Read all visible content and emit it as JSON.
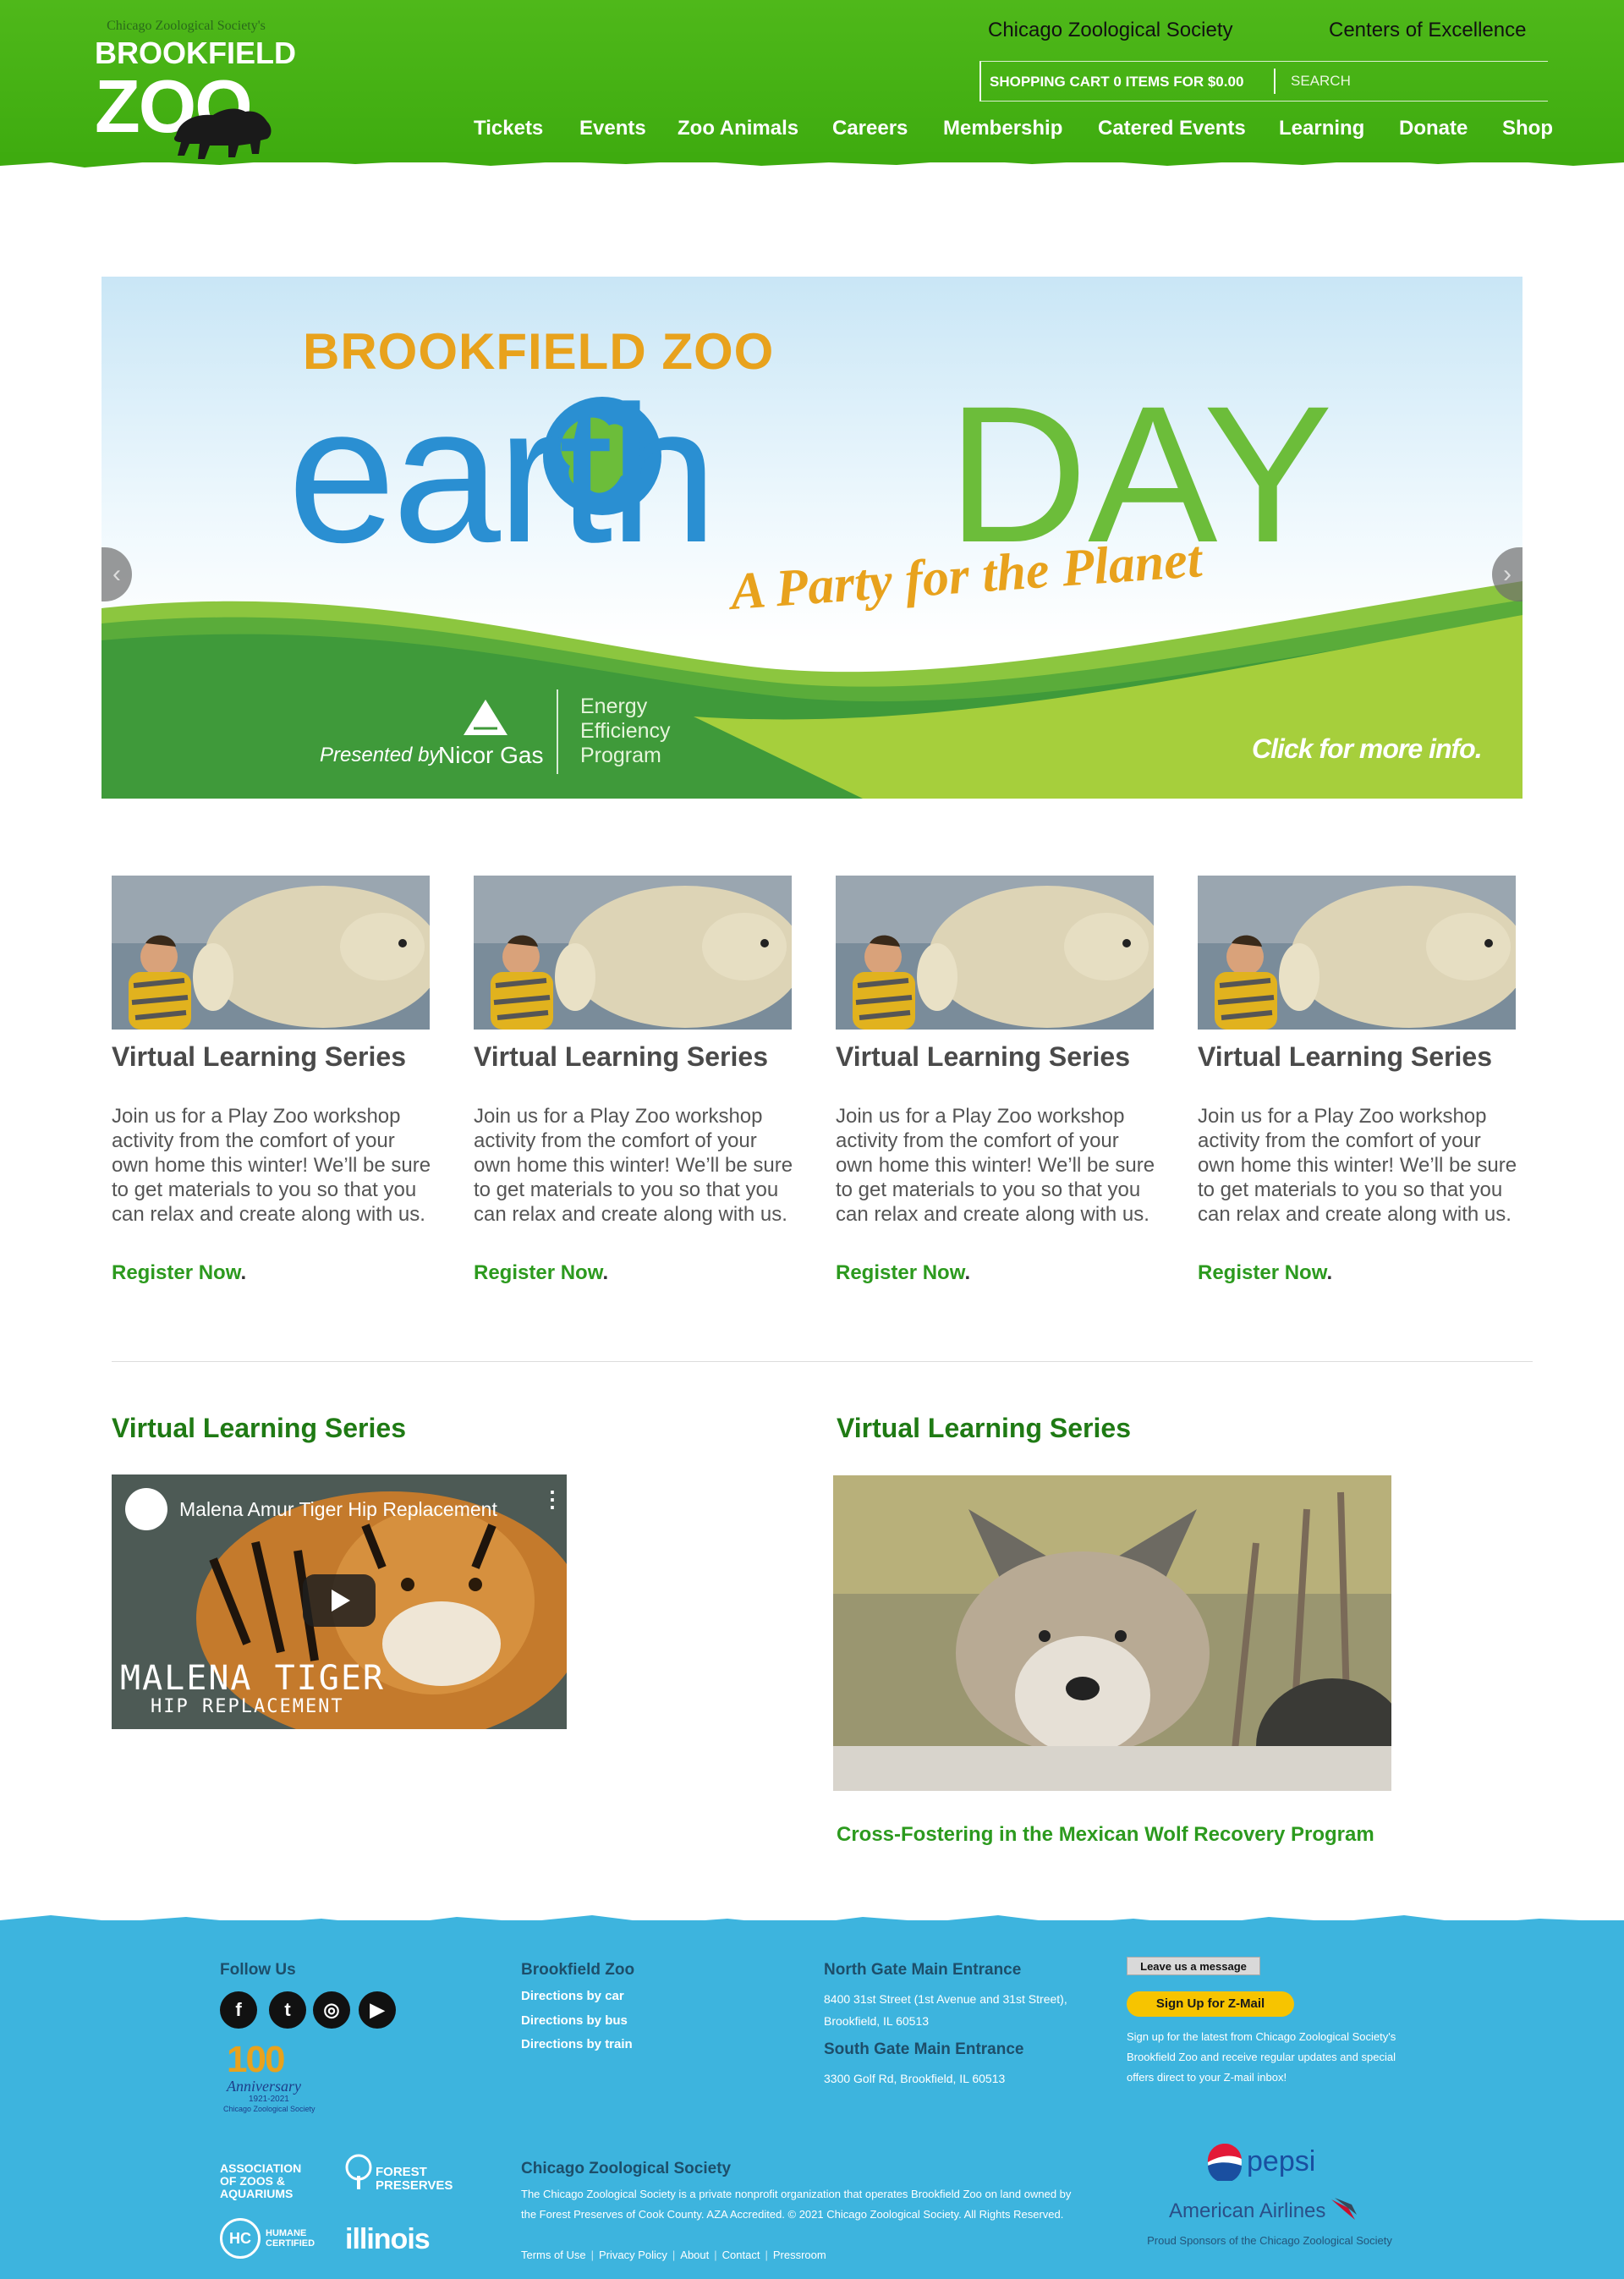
{
  "header": {
    "logo_tagline": "Chicago Zoological Society's",
    "logo_word1": "BROOKFIELD",
    "logo_word2": "ZOO",
    "top_links": [
      "Chicago Zoological Society",
      "Centers of Excellence"
    ],
    "cart_text": "SHOPPING CART 0 ITEMS FOR $0.00",
    "search_placeholder": "SEARCH",
    "nav": [
      "Tickets",
      "Events",
      "Zoo Animals",
      "Careers",
      "Membership",
      "Catered Events",
      "Learning",
      "Donate",
      "Shop"
    ]
  },
  "hero": {
    "brand": "BROOKFIELD ZOO",
    "earth": "earth",
    "day": "DAY",
    "tagline": "A Party for the Planet",
    "presented_by": "Presented by",
    "sponsor": "Nicor Gas",
    "program": "Energy\nEfficiency\nProgram",
    "cta": "Click for more info."
  },
  "cards": [
    {
      "title": "Virtual Learning Series",
      "desc": "Join us for a Play Zoo workshop activity from the comfort of your own home this winter! We’ll be sure to get materials to you so that you can relax and create along with us.",
      "link": "Register Now",
      "punct": "."
    },
    {
      "title": "Virtual Learning Series",
      "desc": "Join us for a Play Zoo workshop activity from the comfort of your own home this winter! We’ll be sure to get materials to you so that you can relax and create along with us.",
      "link": "Register Now",
      "punct": "."
    },
    {
      "title": "Virtual Learning Series",
      "desc": "Join us for a Play Zoo workshop activity from the comfort of your own home this winter! We’ll be sure to get materials to you so that you can relax and create along with us.",
      "link": "Register Now",
      "punct": "."
    },
    {
      "title": "Virtual Learning Series",
      "desc": "Join us for a Play Zoo workshop activity from the comfort of your own home this winter! We’ll be sure to get materials to you so that you can relax and create along with us.",
      "link": "Register Now",
      "punct": "."
    }
  ],
  "features": {
    "left_title": "Virtual Learning Series",
    "video_title": "Malena Amur Tiger Hip Replacement",
    "video_caption_1": "MALENA TIGER",
    "video_caption_2": "HIP REPLACEMENT",
    "right_title": "Virtual Learning Series",
    "wolf_caption": "Cross-Fostering in the Mexican Wolf Recovery Program"
  },
  "footer": {
    "follow_us": "Follow Us",
    "social": [
      "f",
      "t",
      "◎",
      "▶"
    ],
    "anniversary": {
      "number": "100",
      "label": "Anniversary",
      "years": "1921-2021",
      "org": "Chicago Zoological Society"
    },
    "zoo_heading": "Brookfield Zoo",
    "directions": [
      "Directions by car",
      "Directions by bus",
      "Directions by train"
    ],
    "north_heading": "North Gate Main Entrance",
    "north_address": "8400 31st Street (1st Avenue and 31st Street), Brookfield, IL 60513",
    "south_heading": "South Gate Main Entrance",
    "south_address": "3300 Golf Rd, Brookfield, IL 60513",
    "leave_message": "Leave us a message",
    "zmail_button": "Sign Up for Z-Mail",
    "zmail_text": "Sign up for the latest from Chicago Zoological Society's Brookfield Zoo and receive regular updates and special offers direct to your Z-mail inbox!",
    "partners": {
      "aza": "ASSOCIATION OF ZOOS & AQUARIUMS",
      "forest": "FOREST PRESERVES",
      "humane": "HUMANE CERTIFIED",
      "illinois": "illinois"
    },
    "czs_heading": "Chicago Zoological Society",
    "czs_text": "The Chicago Zoological Society is a private nonprofit organization that operates Brookfield Zoo on land owned by the Forest Preserves of Cook County. AZA Accredited. © 2021 Chicago Zoological Society. All Rights Reserved.",
    "legal_links": [
      "Terms of Use",
      "Privacy Policy",
      "About",
      "Contact",
      "Pressroom"
    ],
    "sponsor_pepsi": "pepsi",
    "sponsor_aa": "American Airlines",
    "sponsors_text": "Proud Sponsors of the Chicago Zoological Society"
  },
  "colors": {
    "header_green": "#3eab0f",
    "link_green": "#2c9a1e",
    "heading_green": "#1f7a14",
    "footer_blue": "#3db4de",
    "zmail_yellow": "#f7c400"
  }
}
